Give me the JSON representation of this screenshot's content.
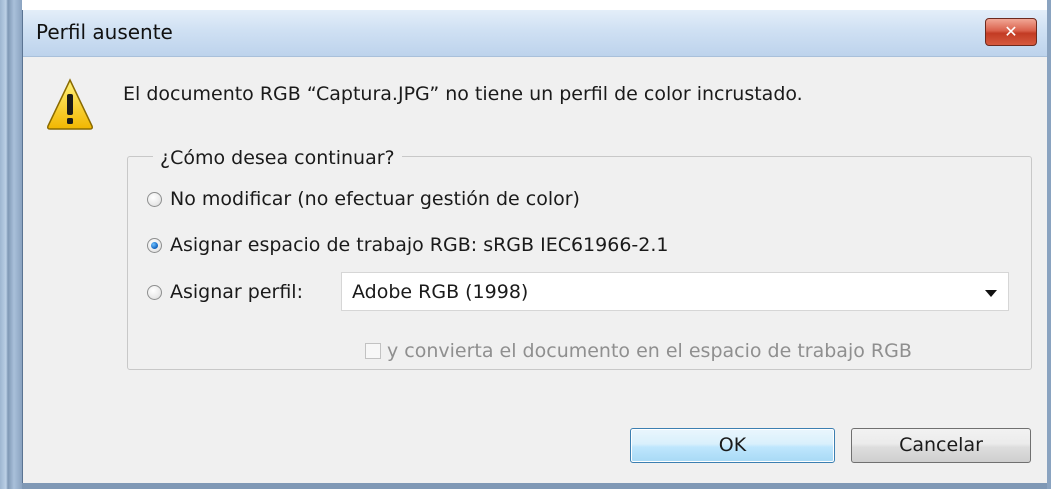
{
  "window": {
    "title": "Perfil ausente",
    "close_glyph": "✕"
  },
  "message": "El documento RGB “Captura.JPG” no tiene un perfil de color incrustado.",
  "group": {
    "legend": "¿Cómo desea continuar?",
    "options": [
      {
        "label": "No modificar (no efectuar gestión de color)",
        "checked": false
      },
      {
        "label": "Asignar espacio de trabajo RGB: sRGB IEC61966-2.1",
        "checked": true
      },
      {
        "label": "Asignar perfil:",
        "checked": false
      }
    ],
    "profile_select": {
      "value": "Adobe RGB (1998)"
    },
    "convert_checkbox": {
      "label": "y convierta el documento en el espacio de trabajo RGB",
      "checked": false,
      "enabled": false
    }
  },
  "buttons": {
    "ok": "OK",
    "cancel": "Cancelar"
  },
  "icons": {
    "warning": "warning-icon",
    "close": "close-icon",
    "dropdown": "chevron-down-icon"
  },
  "colors": {
    "dialog_bg": "#f0f0f0",
    "titlebar": "#cfe0f3",
    "close_button": "#c23b24",
    "ok_border": "#3c7fb1",
    "radio_selected": "#1b6ec8",
    "disabled_text": "#8f8f8f"
  }
}
